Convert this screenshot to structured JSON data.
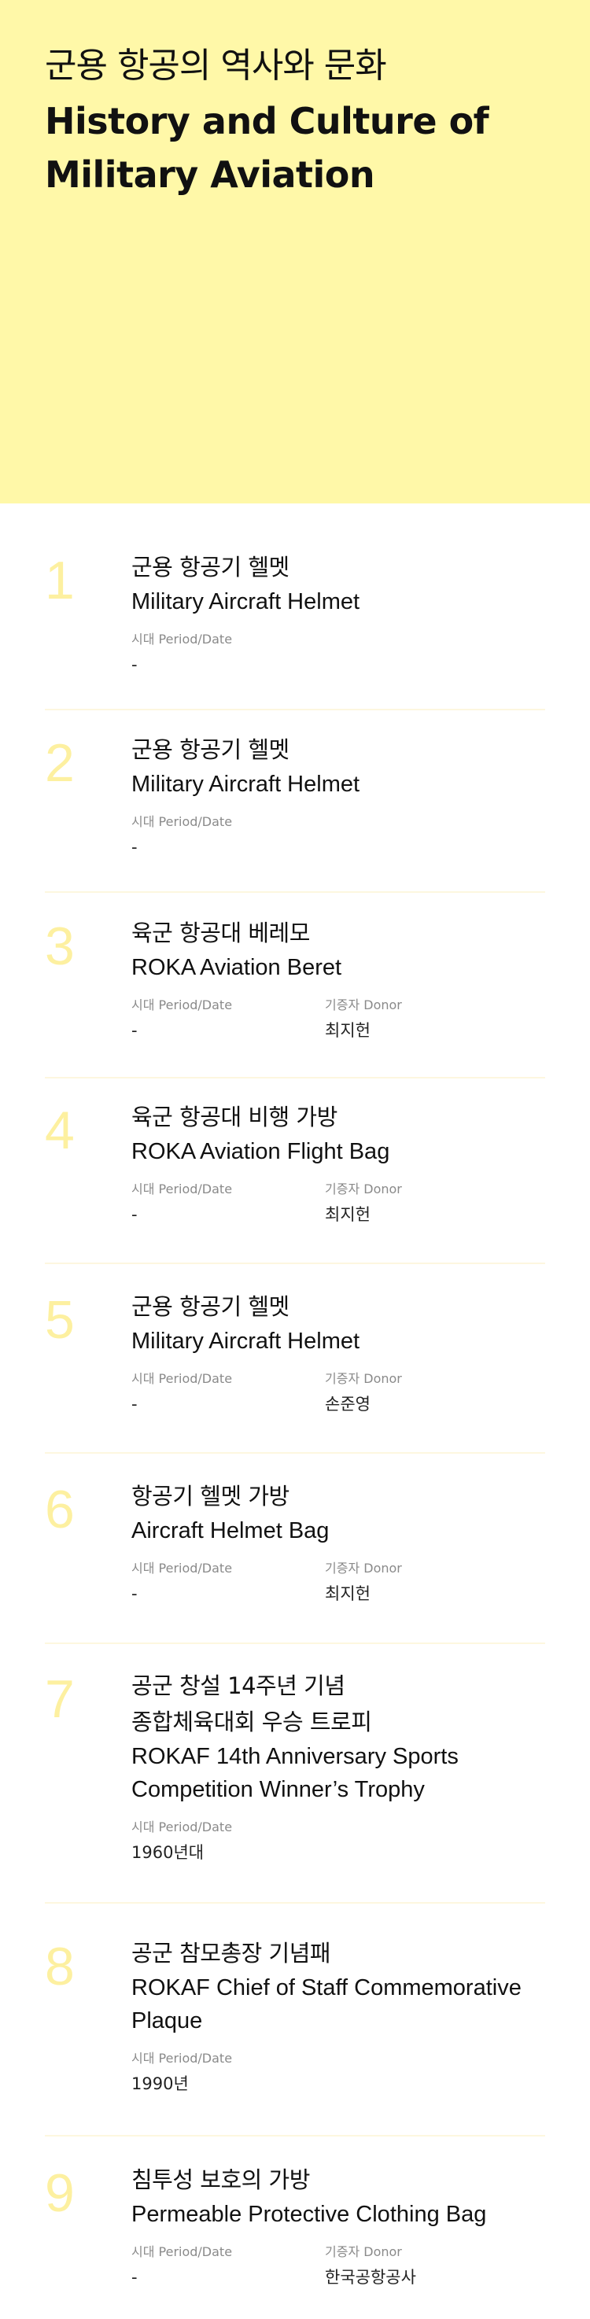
{
  "header": {
    "title_ko": "군용 항공의 역사와 문화",
    "title_en_line1": "History and Culture of",
    "title_en_line2": "Military Aviation"
  },
  "labels": {
    "period": "시대 Period/Date",
    "donor": "기증자 Donor"
  },
  "items": [
    {
      "number": "1",
      "name_ko": "군용 항공기 헬멧",
      "name_en": "Military Aircraft Helmet",
      "period": "-"
    },
    {
      "number": "2",
      "name_ko": "군용 항공기 헬멧",
      "name_en": "Military Aircraft Helmet",
      "period": "-"
    },
    {
      "number": "3",
      "name_ko": "육군 항공대 베레모",
      "name_en": "ROKA Aviation Beret",
      "period": "-",
      "donor": "최지헌"
    },
    {
      "number": "4",
      "name_ko": "육군 항공대 비행 가방",
      "name_en": "ROKA Aviation Flight Bag",
      "period": "-",
      "donor": "최지헌"
    },
    {
      "number": "5",
      "name_ko": "군용 항공기 헬멧",
      "name_en": "Military Aircraft Helmet",
      "period": "-",
      "donor": "손준영"
    },
    {
      "number": "6",
      "name_ko": "항공기 헬멧 가방",
      "name_en": "Aircraft Helmet Bag",
      "period": "-",
      "donor": "최지헌"
    },
    {
      "number": "7",
      "name_ko_line1": "공군 창설 14주년 기념",
      "name_ko_line2": "종합체육대회 우승 트로피",
      "name_en_line1": "ROKAF 14th Anniversary Sports",
      "name_en_line2": "Competition Winner’s Trophy",
      "period": "1960년대"
    },
    {
      "number": "8",
      "name_ko": "공군 참모총장 기념패",
      "name_en_line1": "ROKAF Chief of Staff Commemorative",
      "name_en_line2": "Plaque",
      "period": "1990년"
    },
    {
      "number": "9",
      "name_ko": "침투성 보호의 가방",
      "name_en": "Permeable Protective Clothing Bag",
      "period": "-",
      "donor": "한국공항공사"
    }
  ]
}
